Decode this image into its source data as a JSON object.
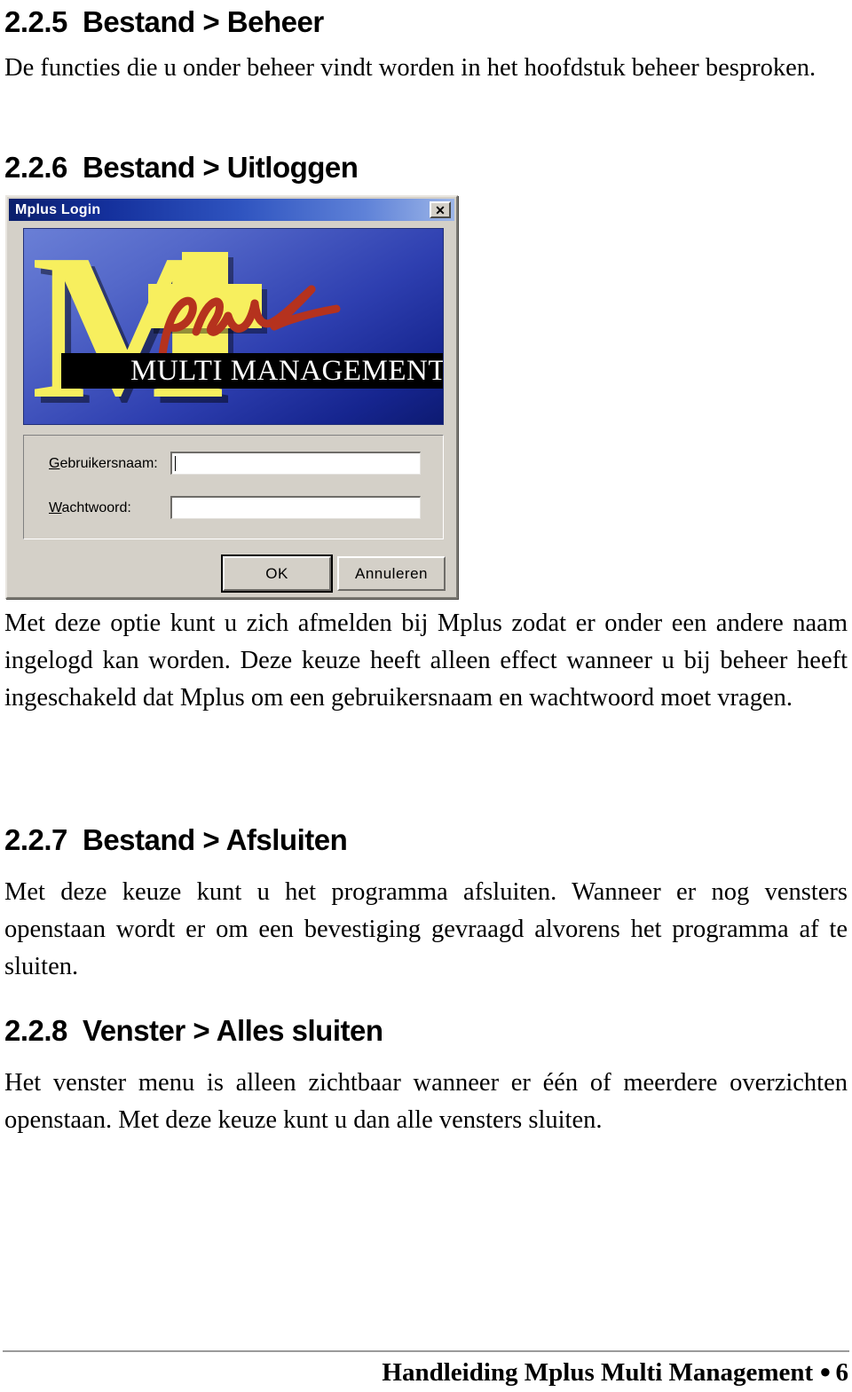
{
  "document": {
    "sections": [
      {
        "number": "2.2.5",
        "title": "Bestand > Beheer",
        "body": "De functies die u onder beheer vindt worden in het hoofdstuk beheer besproken."
      },
      {
        "number": "2.2.6",
        "title": "Bestand > Uitloggen",
        "body": "Met deze optie kunt u zich afmelden bij Mplus zodat er onder een andere naam ingelogd kan worden. Deze keuze heeft alleen effect wanneer u bij beheer heeft ingeschakeld dat Mplus om een gebruikersnaam en wachtwoord moet vragen."
      },
      {
        "number": "2.2.7",
        "title": "Bestand > Afsluiten",
        "body": "Met deze keuze kunt u het programma afsluiten. Wanneer er nog vensters openstaan wordt er om een bevestiging gevraagd alvorens het programma af te sluiten."
      },
      {
        "number": "2.2.8",
        "title": "Venster > Alles sluiten",
        "body": "Het venster menu is alleen zichtbaar wanneer er één of meerdere overzichten openstaan. Met deze keuze kunt u dan alle vensters sluiten."
      }
    ],
    "footer": {
      "text": "Handleiding Mplus Multi Management",
      "bullet": "●",
      "page_number": "6"
    }
  },
  "login_dialog": {
    "title": "Mplus Login",
    "close_label": "✕",
    "logo": {
      "mark": "M",
      "script": "plus",
      "tagline": "MULTI MANAGEMENT",
      "colors": {
        "yellow": "#f7ef5e",
        "red": "#b5321e",
        "blue_dark": "#0d1a72",
        "blue_light": "#6a7fd6"
      }
    },
    "fields": [
      {
        "label_prefix": "G",
        "label_rest": "ebruikersnaam:",
        "value": "",
        "placeholder": ""
      },
      {
        "label_prefix": "W",
        "label_rest": "achtwoord:",
        "value": "",
        "placeholder": ""
      }
    ],
    "buttons": [
      {
        "label": "OK",
        "default": true
      },
      {
        "label": "Annuleren",
        "default": false
      }
    ],
    "titlebar_color": "#14309c"
  }
}
